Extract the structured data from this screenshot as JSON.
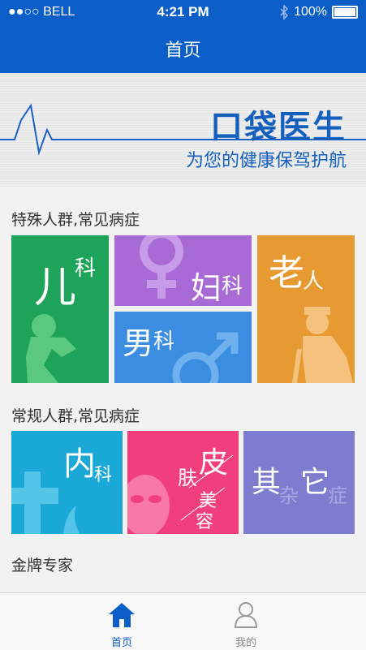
{
  "status": {
    "carrier": "●●○○ BELL",
    "time": "4:21 PM",
    "battery": "100%"
  },
  "header": {
    "title": "首页"
  },
  "banner": {
    "title": "口袋医生",
    "subtitle": "为您的健康保驾护航"
  },
  "sections": {
    "special": "特殊人群,常见病症",
    "regular": "常规人群,常见病症",
    "experts": "金牌专家"
  },
  "tiles": {
    "pediatrics": {
      "big": "儿",
      "small": "科",
      "color": "#1ea35a"
    },
    "gynecology": {
      "big": "妇",
      "small": "科",
      "color": "#a86bd6"
    },
    "andrology": {
      "big": "男",
      "small": "科",
      "color": "#3a8de0"
    },
    "elderly": {
      "big": "老",
      "small": "人",
      "color": "#e89a32"
    },
    "internal": {
      "big": "内",
      "small": "科",
      "color": "#1aa9d6"
    },
    "skin": {
      "big": "皮",
      "small1": "肤",
      "small2": "美",
      "small3": "容",
      "color": "#f03f7c"
    },
    "other": {
      "big1": "其",
      "big2": "它",
      "small1": "杂",
      "small2": "症",
      "color": "#7d7ccf"
    }
  },
  "tabbar": {
    "home": "首页",
    "mine": "我的"
  }
}
